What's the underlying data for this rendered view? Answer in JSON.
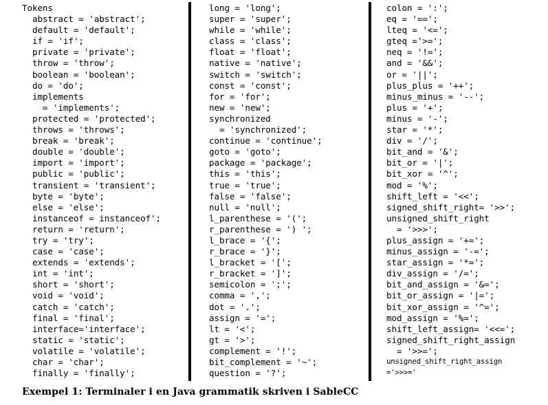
{
  "figure": {
    "caption": "Exempel 1: Terminaler i en Java grammatik skriven i SableCC"
  },
  "columns": [
    {
      "id": "column-1",
      "lines": [
        {
          "text": "Tokens",
          "small": false
        },
        {
          "text": "  abstract = 'abstract';",
          "small": false
        },
        {
          "text": "  default = 'default';",
          "small": false
        },
        {
          "text": "  if = 'if';",
          "small": false
        },
        {
          "text": "  private = 'private';",
          "small": false
        },
        {
          "text": "  throw = 'throw';",
          "small": false
        },
        {
          "text": "  boolean = 'boolean';",
          "small": false
        },
        {
          "text": "  do = 'do';",
          "small": false
        },
        {
          "text": "  implements",
          "small": false
        },
        {
          "text": "    = 'implements';",
          "small": false
        },
        {
          "text": "  protected = 'protected';",
          "small": false
        },
        {
          "text": "  throws = 'throws';",
          "small": false
        },
        {
          "text": "  break = 'break';",
          "small": false
        },
        {
          "text": "  double = 'double';",
          "small": false
        },
        {
          "text": "  import = 'import';",
          "small": false
        },
        {
          "text": "  public = 'public';",
          "small": false
        },
        {
          "text": "  transient = 'transient';",
          "small": false
        },
        {
          "text": "  byte = 'byte';",
          "small": false
        },
        {
          "text": "  else = 'else';",
          "small": false
        },
        {
          "text": "  instanceof = instanceof';",
          "small": false
        },
        {
          "text": "  return = 'return';",
          "small": false
        },
        {
          "text": "  try = 'try';",
          "small": false
        },
        {
          "text": "  case = 'case';",
          "small": false
        },
        {
          "text": "  extends = 'extends';",
          "small": false
        },
        {
          "text": "  int = 'int';",
          "small": false
        },
        {
          "text": "  short = 'short';",
          "small": false
        },
        {
          "text": "  void = 'void';",
          "small": false
        },
        {
          "text": "  catch = 'catch';",
          "small": false
        },
        {
          "text": "  final = 'final';",
          "small": false
        },
        {
          "text": "  interface='interface';",
          "small": false
        },
        {
          "text": "  static = 'static';",
          "small": false
        },
        {
          "text": "  volatile = 'volatile';",
          "small": false
        },
        {
          "text": "  char = 'char';",
          "small": false
        },
        {
          "text": "  finally = 'finally';",
          "small": false
        }
      ]
    },
    {
      "id": "column-2",
      "lines": [
        {
          "text": "long = 'long';",
          "small": false
        },
        {
          "text": "super = 'super';",
          "small": false
        },
        {
          "text": "while = 'while';",
          "small": false
        },
        {
          "text": "class = 'class';",
          "small": false
        },
        {
          "text": "float = 'float';",
          "small": false
        },
        {
          "text": "native = 'native';",
          "small": false
        },
        {
          "text": "switch = 'switch';",
          "small": false
        },
        {
          "text": "const = 'const';",
          "small": false
        },
        {
          "text": "for = 'for';",
          "small": false
        },
        {
          "text": "new = 'new';",
          "small": false
        },
        {
          "text": "synchronized",
          "small": false
        },
        {
          "text": "  = 'synchronized';",
          "small": false
        },
        {
          "text": "continue = 'continue';",
          "small": false
        },
        {
          "text": "goto = 'goto';",
          "small": false
        },
        {
          "text": "package = 'package';",
          "small": false
        },
        {
          "text": "this = 'this';",
          "small": false
        },
        {
          "text": "true = 'true';",
          "small": false
        },
        {
          "text": "false = 'false';",
          "small": false
        },
        {
          "text": "null = 'null';",
          "small": false
        },
        {
          "text": "l_parenthese = '(';",
          "small": false
        },
        {
          "text": "r_parenthese = ') ';",
          "small": false
        },
        {
          "text": "l_brace = '{';",
          "small": false
        },
        {
          "text": "r_brace = '}';",
          "small": false
        },
        {
          "text": "l_bracket = '[';",
          "small": false
        },
        {
          "text": "r_bracket = ']';",
          "small": false
        },
        {
          "text": "semicolon = ';';",
          "small": false
        },
        {
          "text": "comma = ',';",
          "small": false
        },
        {
          "text": "dot = '.';",
          "small": false
        },
        {
          "text": "assign = '=';",
          "small": false
        },
        {
          "text": "lt = '<';",
          "small": false
        },
        {
          "text": "gt = '>';",
          "small": false
        },
        {
          "text": "complement = '!';",
          "small": false
        },
        {
          "text": "bit_complement = '~';",
          "small": false
        },
        {
          "text": "question = '?';",
          "small": false
        }
      ]
    },
    {
      "id": "column-3",
      "lines": [
        {
          "text": "colon = ':';",
          "small": false
        },
        {
          "text": "eq = '==';",
          "small": false
        },
        {
          "text": "lteq = '<=';",
          "small": false
        },
        {
          "text": "gteq ='>=';",
          "small": false
        },
        {
          "text": "neq = '!=';",
          "small": false
        },
        {
          "text": "and = '&&';",
          "small": false
        },
        {
          "text": "or = '||';",
          "small": false
        },
        {
          "text": "plus_plus = '++';",
          "small": false
        },
        {
          "text": "minus_minus = '--';",
          "small": false
        },
        {
          "text": "plus = '+';",
          "small": false
        },
        {
          "text": "minus = '-';",
          "small": false
        },
        {
          "text": "star = '*';",
          "small": false
        },
        {
          "text": "div = '/';",
          "small": false
        },
        {
          "text": "bit_and = '&';",
          "small": false
        },
        {
          "text": "bit_or = '|';",
          "small": false
        },
        {
          "text": "bit_xor = '^';",
          "small": false
        },
        {
          "text": "mod = '%';",
          "small": false
        },
        {
          "text": "shift_left = '<<';",
          "small": false
        },
        {
          "text": "signed_shift_right= '>>';",
          "small": false
        },
        {
          "text": "unsigned_shift_right",
          "small": false
        },
        {
          "text": "  = '>>>';",
          "small": false
        },
        {
          "text": "plus_assign = '+=';",
          "small": false
        },
        {
          "text": "minus_assign = '-=';",
          "small": false
        },
        {
          "text": "star_assign = '*=';",
          "small": false
        },
        {
          "text": "div_assign = '/=';",
          "small": false
        },
        {
          "text": "bit_and_assign = '&=';",
          "small": false
        },
        {
          "text": "bit_or_assign = '|=';",
          "small": false
        },
        {
          "text": "bit_xor_assign = '^=';",
          "small": false
        },
        {
          "text": "mod_assign = '%=';",
          "small": false
        },
        {
          "text": "shift_left_assign= '<<=';",
          "small": false
        },
        {
          "text": "signed_shift_right_assign",
          "small": false
        },
        {
          "text": "  = '>>=';",
          "small": false
        },
        {
          "text": "unsigned_shift_right_assign",
          "small": true
        },
        {
          "text": "='>>>='",
          "small": true
        }
      ]
    }
  ]
}
